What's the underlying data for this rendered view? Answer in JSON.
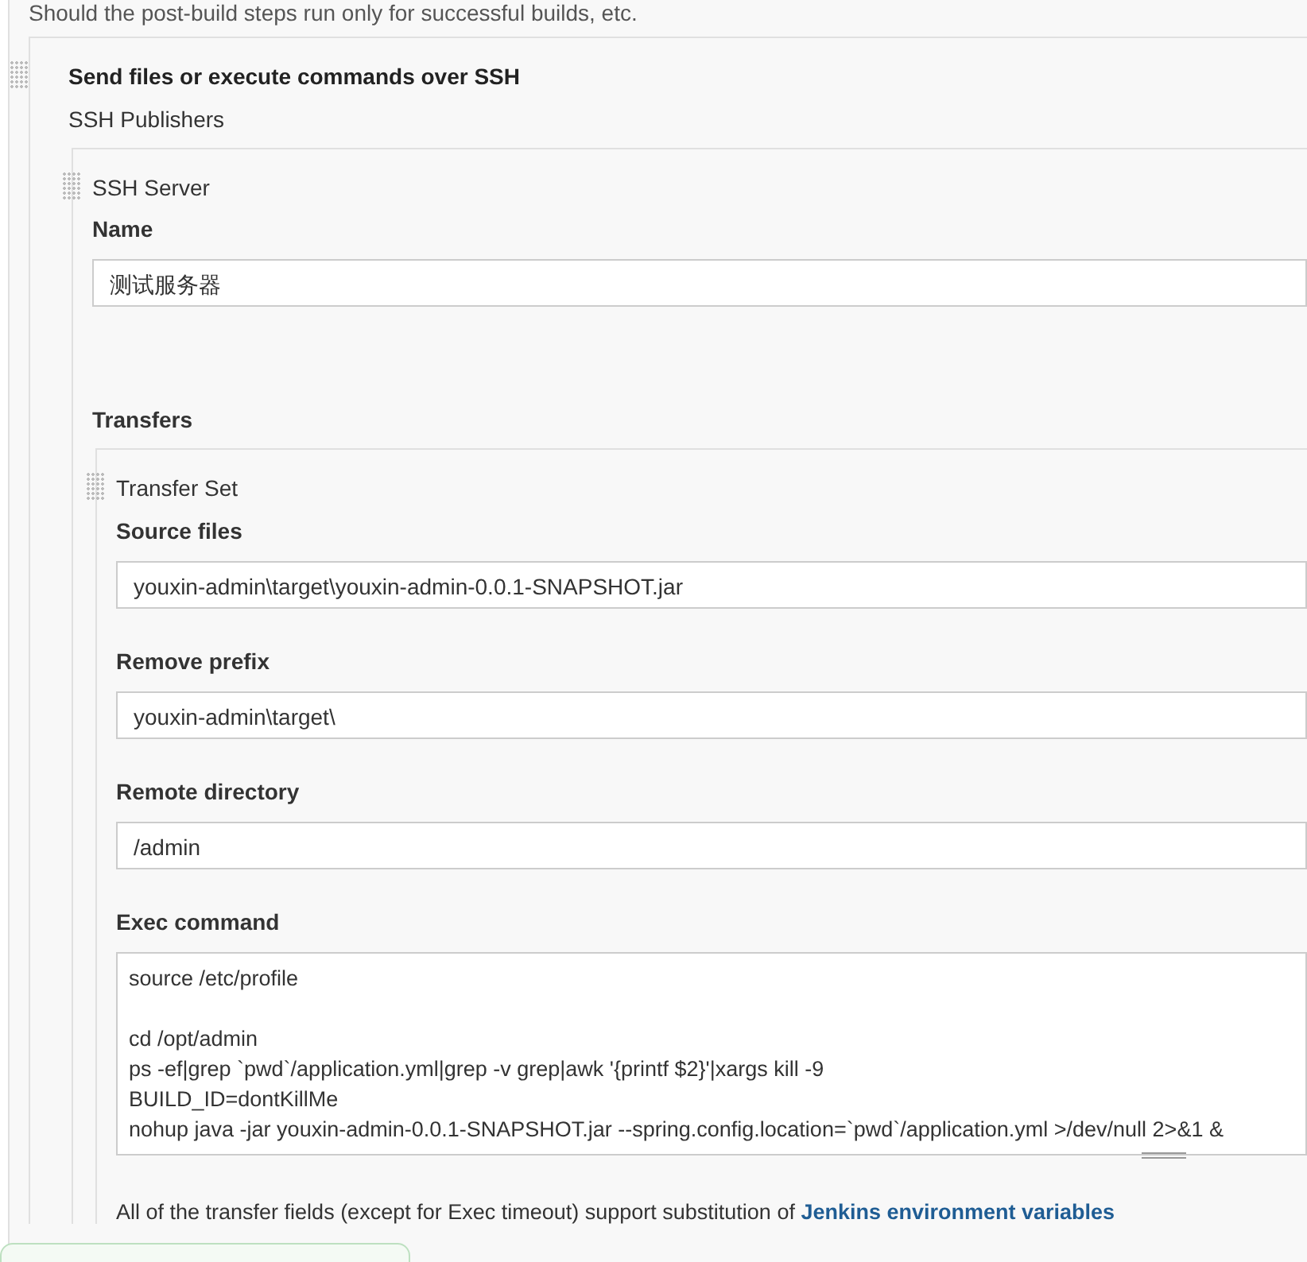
{
  "top_help": "Should the post-build steps run only for successful builds, etc.",
  "publisher": {
    "title": "Send files or execute commands over SSH",
    "subtitle": "SSH Publishers",
    "server": {
      "heading": "SSH Server",
      "fields": [
        {
          "label": "Name",
          "kind": "text",
          "value": "测试服务器"
        }
      ],
      "transfers_label": "Transfers",
      "transfer_set": {
        "heading": "Transfer Set",
        "fields": [
          {
            "label": "Source files",
            "kind": "text",
            "value": "youxin-admin\\target\\youxin-admin-0.0.1-SNAPSHOT.jar"
          },
          {
            "label": "Remove prefix",
            "kind": "text",
            "value": "youxin-admin\\target\\"
          },
          {
            "label": "Remote directory",
            "kind": "text",
            "value": "/admin"
          },
          {
            "label": "Exec command",
            "kind": "textarea",
            "value": "source /etc/profile\n\ncd /opt/admin\nps -ef|grep `pwd`/application.yml|grep -v grep|awk '{printf $2}'|xargs kill -9\nBUILD_ID=dontKillMe\nnohup java -jar youxin-admin-0.0.1-SNAPSHOT.jar --spring.config.location=`pwd`/application.yml >/dev/null 2>&1 &"
          }
        ],
        "help": {
          "text": "All of the transfer fields (except for Exec timeout) support substitution of ",
          "link": "Jenkins environment variables"
        }
      }
    }
  }
}
